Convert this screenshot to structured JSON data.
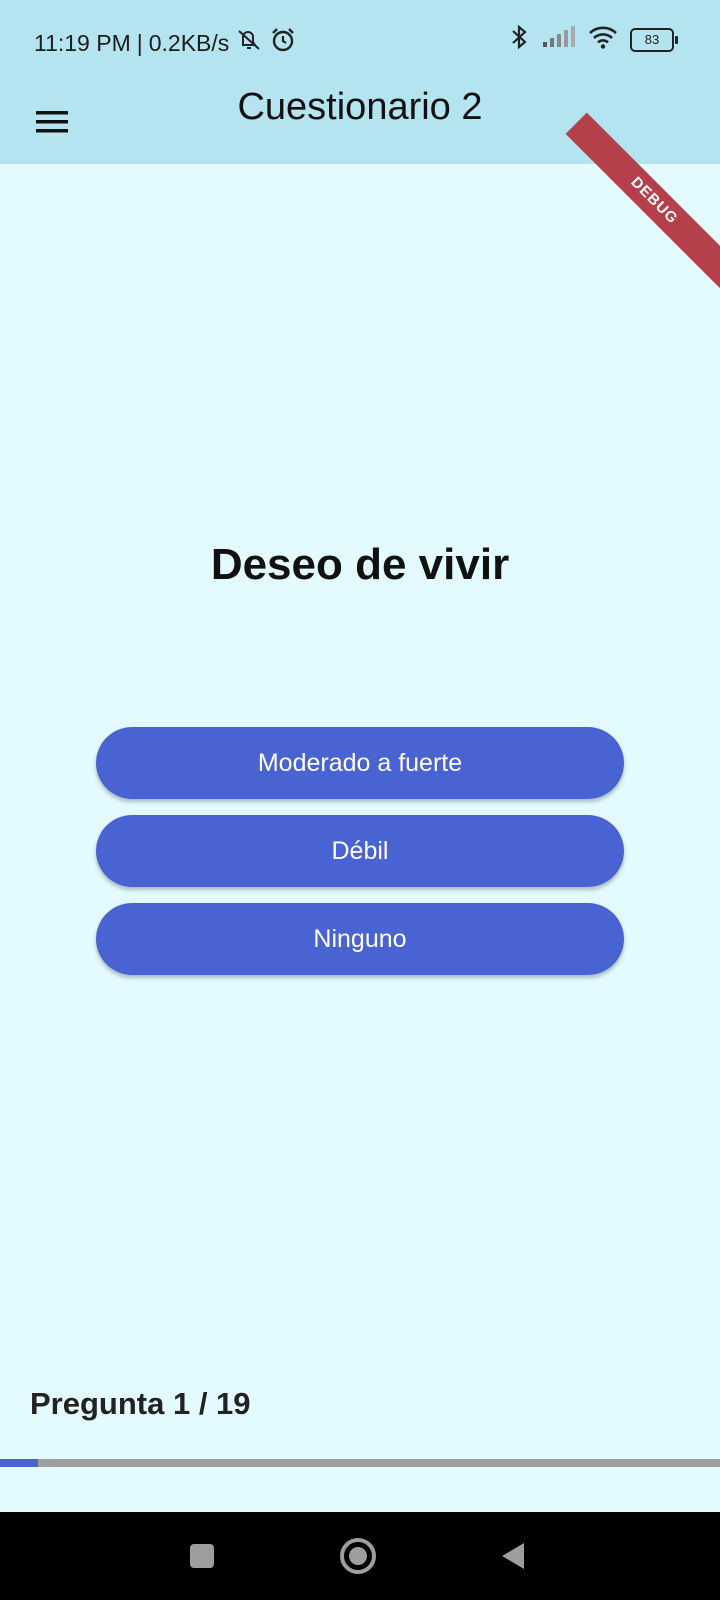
{
  "status_bar": {
    "time": "11:19 PM",
    "speed": "0.2KB/s",
    "battery": "83",
    "icons": [
      "mute-bell-icon",
      "alarm-icon",
      "bluetooth-icon",
      "signal-icon",
      "wifi-icon",
      "battery-icon"
    ]
  },
  "app_bar": {
    "title": "Cuestionario 2",
    "menu_icon": "hamburger-menu-icon"
  },
  "debug_banner": "DEBUG",
  "question": {
    "text": "Deseo de vivir",
    "answers": [
      "Moderado a fuerte",
      "Débil",
      "Ninguno"
    ]
  },
  "progress": {
    "label": "Pregunta 1 / 19",
    "current": 1,
    "total": 19,
    "fraction": 0.0526
  },
  "nav_bar": {
    "icons": [
      "recent-apps-icon",
      "home-icon",
      "back-icon"
    ]
  },
  "colors": {
    "app_bar": "#b3e4ef",
    "background": "#e3fbfe",
    "button": "#4a63d3",
    "progress_track": "#9e9e9e",
    "debug": "#b3404a"
  }
}
